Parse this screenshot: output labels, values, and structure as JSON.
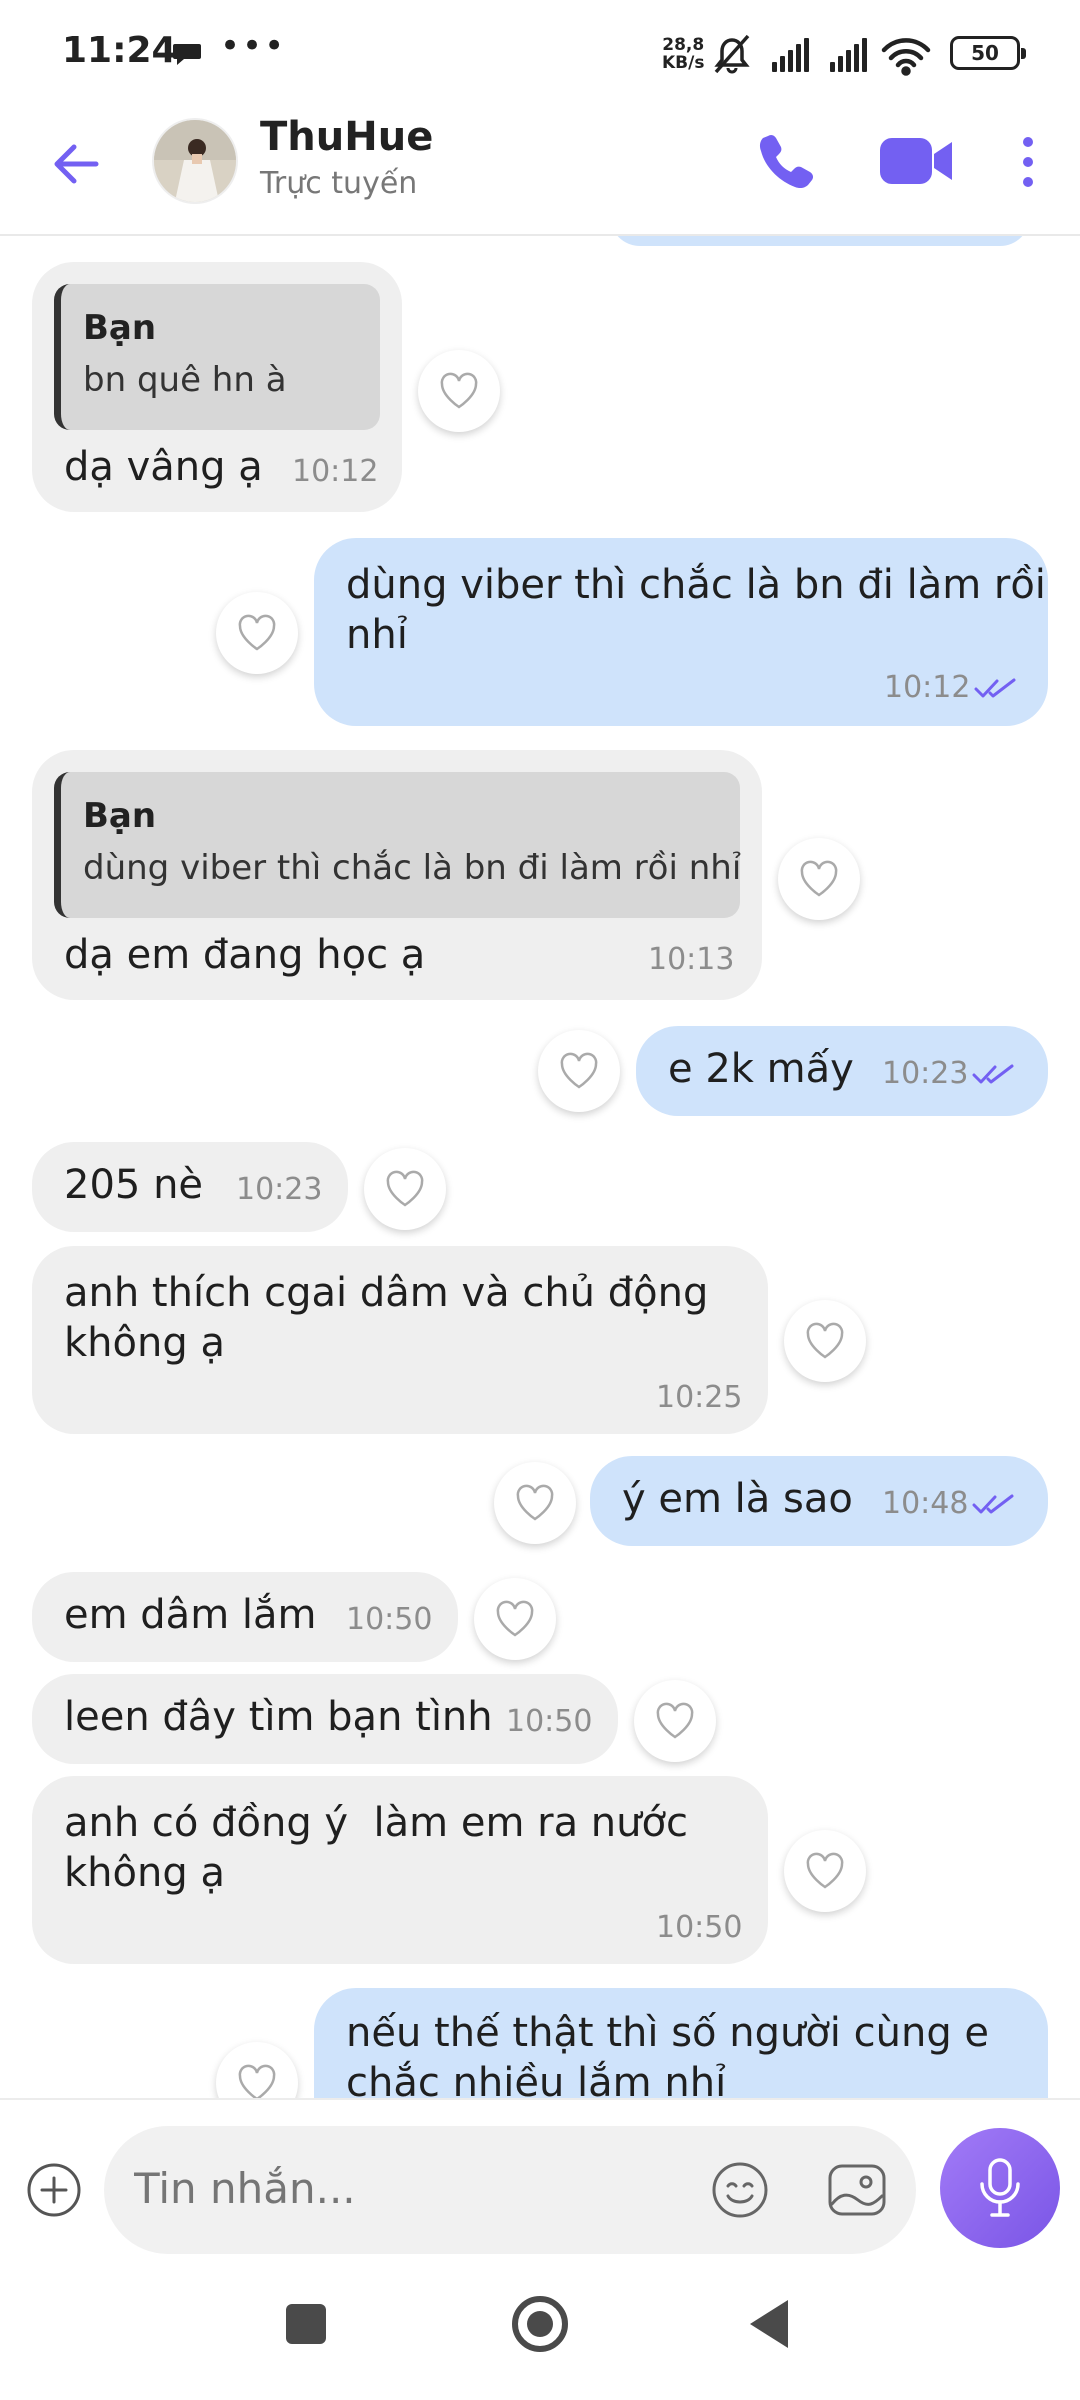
{
  "status_bar": {
    "time": "11:24",
    "net_speed_value": "28,8",
    "net_speed_unit": "KB/s",
    "battery": "50"
  },
  "header": {
    "contact_name": "ThuHue",
    "contact_status": "Trực tuyến",
    "accent_color": "#7360f2"
  },
  "messages": [
    {
      "dir": "in",
      "quote_name": "Bạn",
      "quote_text": "bn quê hn à",
      "text": "dạ vâng ạ",
      "time": "10:12"
    },
    {
      "dir": "out",
      "text_line1": "dùng viber thì chắc là bn đi làm rồi",
      "text_line2": "nhỉ",
      "time": "10:12",
      "status": "read"
    },
    {
      "dir": "in",
      "quote_name": "Bạn",
      "quote_text": "dùng viber thì chắc là bn đi làm rồi nhỉ",
      "text": "dạ em đang học ạ",
      "time": "10:13"
    },
    {
      "dir": "out",
      "text": "e 2k mấy",
      "time": "10:23",
      "status": "read"
    },
    {
      "dir": "in",
      "text": "205 nè",
      "time": "10:23"
    },
    {
      "dir": "in",
      "text_line1": "anh thích cgai dâm và chủ động",
      "text_line2": "không ạ",
      "time": "10:25"
    },
    {
      "dir": "out",
      "text": "ý em là sao",
      "time": "10:48",
      "status": "read"
    },
    {
      "dir": "in",
      "text": "em dâm lắm",
      "time": "10:50"
    },
    {
      "dir": "in",
      "text": "leen đây tìm bạn tình",
      "time": "10:50"
    },
    {
      "dir": "in",
      "text_line1": "anh có đồng ý  làm em ra nước",
      "text_line2": "không ạ",
      "time": "10:50"
    },
    {
      "dir": "out",
      "text_line1": "nếu thế thật thì số người cùng e",
      "text_line2": "chắc nhiều lắm nhỉ"
    }
  ],
  "composer": {
    "placeholder": "Tin nhắn..."
  },
  "colors": {
    "incoming_bubble": "#efefef",
    "outgoing_bubble": "#cfe3fb",
    "read_ticks": "#7360f2"
  }
}
